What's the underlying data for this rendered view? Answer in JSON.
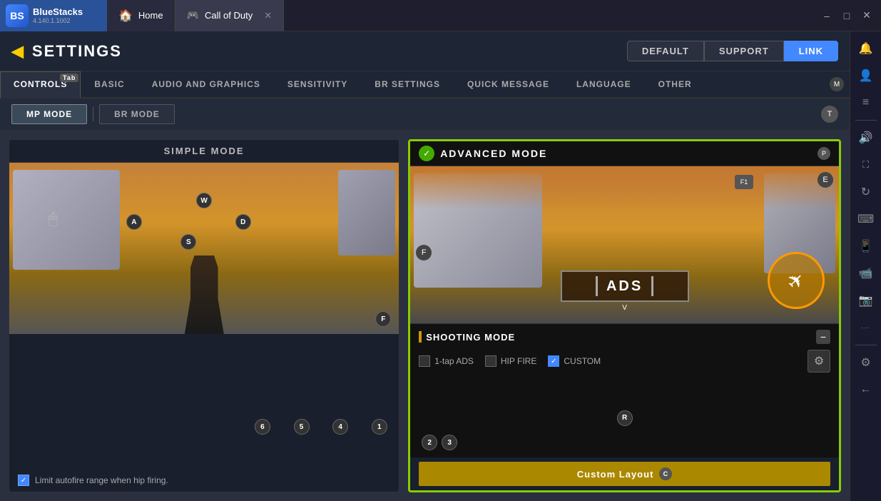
{
  "titlebar": {
    "app_name": "BlueStacks",
    "app_version": "4.140.1.1002",
    "home_tab": "Home",
    "game_tab": "Call of Duty",
    "minimize": "–",
    "maximize": "□",
    "close": "✕"
  },
  "settings": {
    "back_arrow": "◀",
    "title": "SETTINGS",
    "btn_default": "DEFAULT",
    "btn_support": "SUPPORT",
    "btn_link": "LINK"
  },
  "tabs": [
    {
      "id": "controls",
      "label": "CONTROLS",
      "active": true,
      "badge": "Tab"
    },
    {
      "id": "basic",
      "label": "BASIC",
      "active": false
    },
    {
      "id": "audio_graphics",
      "label": "AUDIO AND GRAPHICS",
      "active": false
    },
    {
      "id": "sensitivity",
      "label": "SENSITIVITY",
      "active": false
    },
    {
      "id": "br_settings",
      "label": "BR SETTINGS",
      "active": false
    },
    {
      "id": "quick_message",
      "label": "QUICK MESSAGE",
      "active": false
    },
    {
      "id": "language",
      "label": "LANGUAGE",
      "active": false
    },
    {
      "id": "other",
      "label": "OTHER",
      "active": false
    }
  ],
  "modes": {
    "mp_mode": "MP MODE",
    "br_mode": "BR MODE",
    "t_badge": "T"
  },
  "simple_panel": {
    "title": "SIMPLE MODE",
    "keys": [
      "W",
      "A",
      "D",
      "S",
      "6",
      "5",
      "4",
      "1",
      "F"
    ],
    "checkbox_text": "Limit autofire range when hip firing.",
    "bottom_keys": [
      "6",
      "5",
      "4",
      "1"
    ]
  },
  "advanced_panel": {
    "title": "ADVANCED MODE",
    "check_icon": "✓",
    "p_badge": "P",
    "e_badge": "E",
    "f1_label": "F1",
    "f_badge": "F",
    "r_badge": "R",
    "v_badge": "V",
    "ads_text": "ADS",
    "shooting_mode_title": "SHOOTING MODE",
    "options": [
      {
        "label": "1-tap ADS",
        "checked": false
      },
      {
        "label": "HIP FIRE",
        "checked": false
      },
      {
        "label": "CUSTOM",
        "checked": true
      }
    ],
    "bottom_keys": [
      "2",
      "3"
    ],
    "custom_layout_btn": "Custom Layout",
    "c_badge": "C",
    "minus": "−"
  },
  "sidebar": {
    "icons": [
      {
        "name": "notification-icon",
        "symbol": "🔔"
      },
      {
        "name": "account-icon",
        "symbol": "👤"
      },
      {
        "name": "menu-icon",
        "symbol": "≡"
      },
      {
        "name": "volume-icon",
        "symbol": "🔊"
      },
      {
        "name": "fullscreen-icon",
        "symbol": "⛶"
      },
      {
        "name": "rotate-icon",
        "symbol": "↻"
      },
      {
        "name": "keyboard-icon",
        "symbol": "⌨"
      },
      {
        "name": "phone-icon",
        "symbol": "📱"
      },
      {
        "name": "video-icon",
        "symbol": "📹"
      },
      {
        "name": "camera-icon",
        "symbol": "📷"
      },
      {
        "name": "dots-icon",
        "symbol": "···"
      },
      {
        "name": "settings-icon",
        "symbol": "⚙"
      },
      {
        "name": "back-icon",
        "symbol": "←"
      }
    ]
  }
}
